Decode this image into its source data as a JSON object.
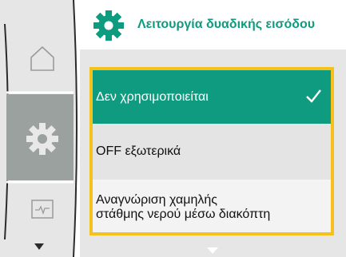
{
  "header": {
    "title": "Λειτουργία δυαδικής εισόδου",
    "icon": "gear-icon"
  },
  "rail": {
    "items": [
      {
        "icon": "home-icon",
        "selected": false
      },
      {
        "icon": "settings-gear-icon",
        "selected": true
      },
      {
        "icon": "monitor-icon",
        "selected": false
      }
    ],
    "scroll": "chevron-down-icon"
  },
  "menu": {
    "items": [
      {
        "label": "Δεν χρησιμοποιείται",
        "selected": true,
        "check_icon": "check-icon"
      },
      {
        "label": "OFF εξωτερικά",
        "selected": false
      },
      {
        "label": "Αναγνώριση χαμηλής\nστάθμης νερού μέσω διακόπτη",
        "selected": false
      }
    ],
    "scroll": "chevron-down-icon"
  },
  "colors": {
    "accent": "#0f9b7f",
    "focus": "#f5c21b",
    "rail_selected": "#9aa19e",
    "rail": "#e6e6e6"
  }
}
